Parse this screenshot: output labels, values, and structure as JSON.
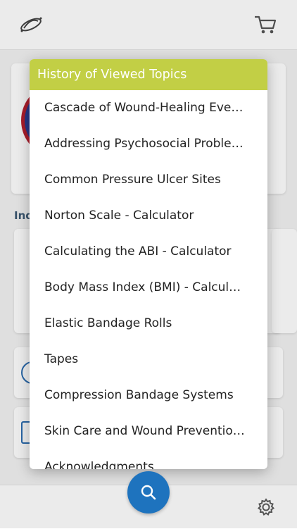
{
  "colors": {
    "header_accent": "#c2cf45",
    "fab_blue": "#1e73be",
    "text": "#222222"
  },
  "icons": {
    "logo": "galaxy-logo-icon",
    "cart": "shopping-cart-icon",
    "search": "search-icon",
    "settings": "gear-icon"
  },
  "background": {
    "section_label": "Ind"
  },
  "history_modal": {
    "title": "History of Viewed Topics",
    "items": [
      "Cascade of Wound-Healing Events",
      "Addressing Psychosocial Problems",
      "Common Pressure Ulcer Sites",
      "Norton Scale - Calculator",
      "Calculating the ABI - Calculator",
      "Body Mass Index (BMI) - Calculator",
      "Elastic Bandage Rolls",
      "Tapes",
      "Compression Bandage Systems",
      "Skin Care and Wound Prevention Protocols",
      "Acknowledgments"
    ]
  }
}
